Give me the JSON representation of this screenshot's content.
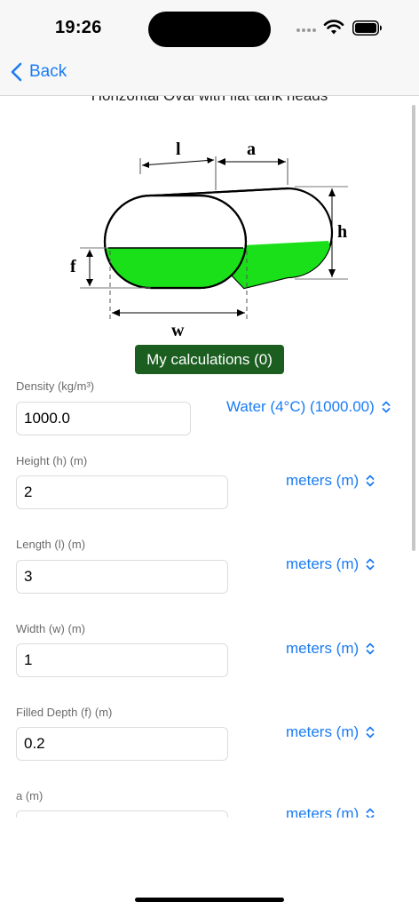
{
  "status": {
    "time": "19:26",
    "signal_icon": "cellular-dots-icon",
    "wifi_icon": "wifi-icon",
    "battery_icon": "battery-icon"
  },
  "nav": {
    "back_label": "Back",
    "back_icon": "chevron-left-icon"
  },
  "page": {
    "partial_title": "Horizontal Oval with flat tank heads"
  },
  "diagram": {
    "labels": {
      "l": "l",
      "a": "a",
      "h": "h",
      "f": "f",
      "w": "w"
    },
    "fill_color": "#19e019"
  },
  "calculations_button": "My calculations (0)",
  "fields": [
    {
      "label": "Density (kg/m³)",
      "value": "1000.0",
      "unit": "Water (4°C) (1000.00)"
    },
    {
      "label": "Height (h) (m)",
      "value": "2",
      "unit": "meters (m)"
    },
    {
      "label": "Length (l) (m)",
      "value": "3",
      "unit": "meters (m)"
    },
    {
      "label": "Width (w) (m)",
      "value": "1",
      "unit": "meters (m)"
    },
    {
      "label": "Filled Depth (f) (m)",
      "value": "0.2",
      "unit": "meters (m)"
    },
    {
      "label": "a (m)",
      "value": "",
      "unit": "meters (m)"
    }
  ],
  "colors": {
    "accent": "#1a7cf5",
    "button_green": "#1b5e20"
  }
}
